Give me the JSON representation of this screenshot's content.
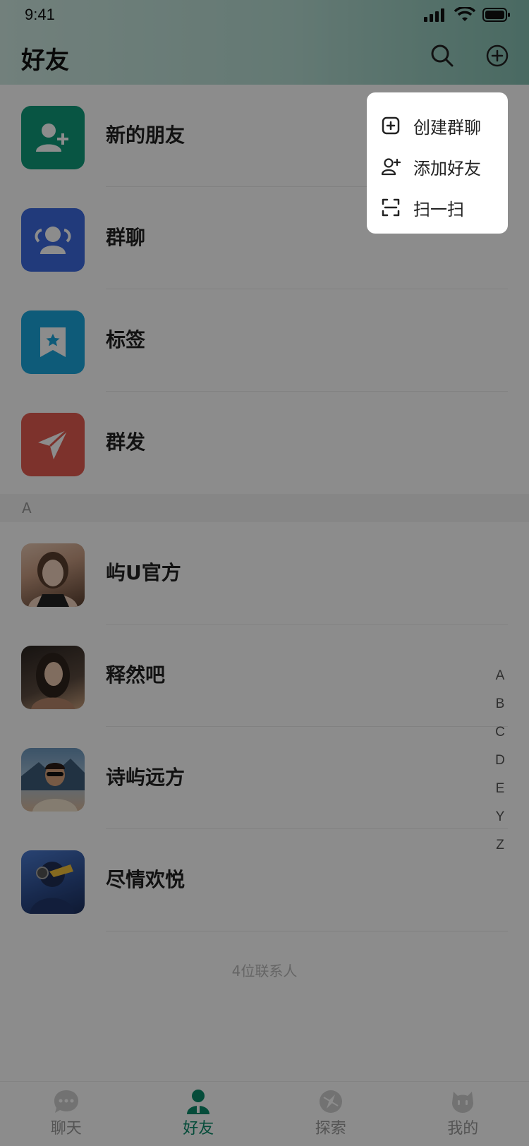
{
  "status": {
    "time": "9:41"
  },
  "header": {
    "title": "好友"
  },
  "features": [
    {
      "label": "新的朋友",
      "icon": "add-friend-icon",
      "color": "#0f9b7a"
    },
    {
      "label": "群聊",
      "icon": "group-icon",
      "color": "#3d6ae0"
    },
    {
      "label": "标签",
      "icon": "tag-bookmark-icon",
      "color": "#1aa7dc"
    },
    {
      "label": "群发",
      "icon": "send-plane-icon",
      "color": "#e35b50"
    }
  ],
  "section": {
    "letter": "A"
  },
  "contacts": [
    {
      "name": "屿U官方",
      "avatar_colors": [
        "#e8c9b3",
        "#5a3f2f"
      ]
    },
    {
      "name": "释然吧",
      "avatar_colors": [
        "#3b332e",
        "#c9a07d"
      ]
    },
    {
      "name": "诗屿远方",
      "avatar_colors": [
        "#7fa9c9",
        "#d9b89a"
      ]
    },
    {
      "name": "尽情欢悦",
      "avatar_colors": [
        "#2b4a8a",
        "#f3c23b"
      ]
    }
  ],
  "contact_count": "4位联系人",
  "alphabet": [
    "A",
    "B",
    "C",
    "D",
    "E",
    "Y",
    "Z"
  ],
  "nav": [
    {
      "label": "聊天",
      "icon": "chat-icon"
    },
    {
      "label": "好友",
      "icon": "friends-icon",
      "active": true
    },
    {
      "label": "探索",
      "icon": "explore-icon"
    },
    {
      "label": "我的",
      "icon": "profile-icon"
    }
  ],
  "menu": [
    {
      "label": "创建群聊",
      "icon": "create-group-icon"
    },
    {
      "label": "添加好友",
      "icon": "add-user-icon"
    },
    {
      "label": "扫一扫",
      "icon": "scan-icon"
    }
  ],
  "colors": {
    "accent": "#0a8a6a"
  }
}
